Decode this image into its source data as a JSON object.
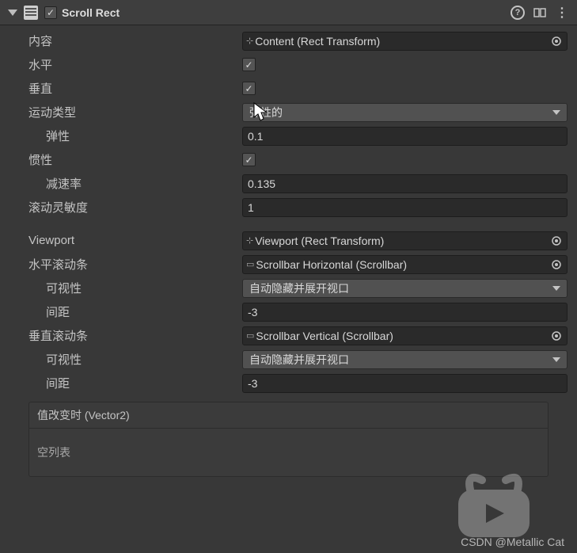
{
  "header": {
    "title": "Scroll Rect",
    "enabled": true
  },
  "props": {
    "content": {
      "label": "内容",
      "value": "Content (Rect Transform)"
    },
    "horizontal": {
      "label": "水平",
      "value": true
    },
    "vertical": {
      "label": "垂直",
      "value": true
    },
    "movement_type": {
      "label": "运动类型",
      "value": "弹性的"
    },
    "elasticity": {
      "label": "弹性",
      "value": "0.1"
    },
    "inertia": {
      "label": "惯性",
      "value": true
    },
    "decel_rate": {
      "label": "减速率",
      "value": "0.135"
    },
    "scroll_sensitivity": {
      "label": "滚动灵敏度",
      "value": "1"
    },
    "viewport": {
      "label": "Viewport",
      "value": "Viewport (Rect Transform)"
    },
    "h_scrollbar": {
      "label": "水平滚动条",
      "value": "Scrollbar Horizontal (Scrollbar)"
    },
    "h_visibility": {
      "label": "可视性",
      "value": "自动隐藏并展开视口"
    },
    "h_spacing": {
      "label": "间距",
      "value": "-3"
    },
    "v_scrollbar": {
      "label": "垂直滚动条",
      "value": "Scrollbar Vertical (Scrollbar)"
    },
    "v_visibility": {
      "label": "可视性",
      "value": "自动隐藏并展开视口"
    },
    "v_spacing": {
      "label": "间距",
      "value": "-3"
    }
  },
  "event": {
    "title": "值改变时 (Vector2)",
    "empty": "空列表"
  },
  "watermark": "CSDN @Metallic Cat"
}
